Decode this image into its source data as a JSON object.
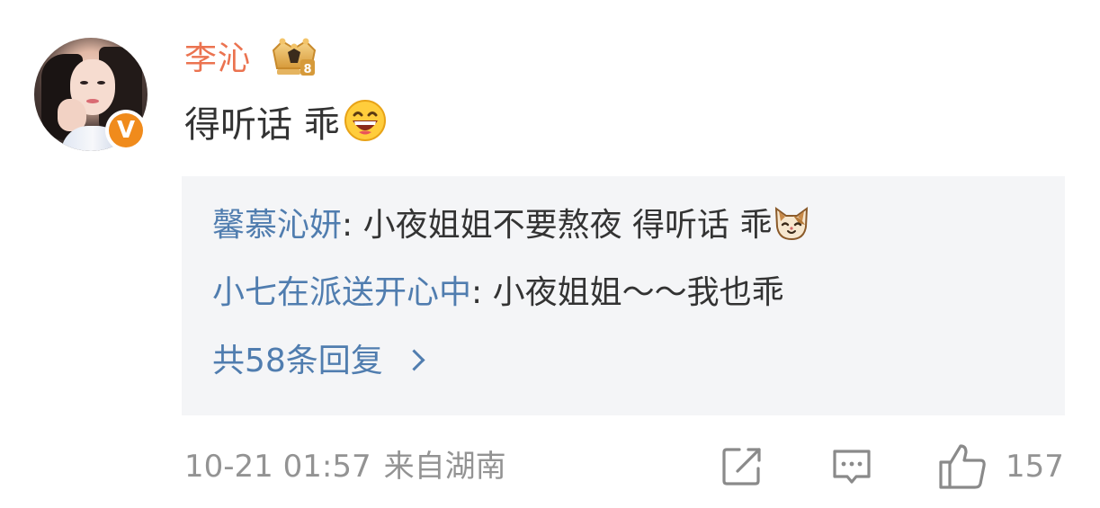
{
  "comment": {
    "user_name": "李沁",
    "text": "得听话 乖",
    "verified_badge": "V",
    "avatar": "avatar",
    "crown_icon": "vip-crown-icon",
    "emoji": "grinning-emoji-icon"
  },
  "replies": {
    "items": [
      {
        "name": "馨慕沁妍",
        "separator": ": ",
        "text": "小夜姐姐不要熬夜 得听话 乖",
        "emoji": "cat-emoji-icon"
      },
      {
        "name": "小七在派送开心中",
        "separator": ": ",
        "text": "小夜姐姐～～我也乖"
      }
    ],
    "more_label": "共58条回复"
  },
  "footer": {
    "time": "10-21 01:57",
    "source": "来自湖南",
    "like_count": "157",
    "share_icon": "share-icon",
    "reply_icon": "comment-icon",
    "like_icon": "thumbs-up-icon"
  },
  "colors": {
    "name": "#eb7350",
    "link": "#507daf",
    "text": "#333333",
    "meta": "#939393",
    "reply_bg": "#f4f5f7",
    "badge": "#f08b1c"
  }
}
